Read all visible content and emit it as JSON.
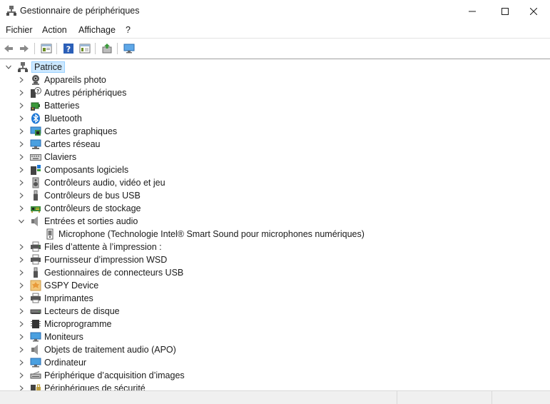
{
  "window": {
    "title": "Gestionnaire de périphériques"
  },
  "menu": {
    "items": [
      "Fichier",
      "Action",
      "Affichage",
      "?"
    ]
  },
  "toolbar": {
    "buttons": [
      "back-icon",
      "forward-icon",
      "properties-icon",
      "help-icon",
      "view-icon",
      "update-driver-icon",
      "monitor-scan-icon"
    ]
  },
  "tree": {
    "root": "Patrice",
    "categories": [
      {
        "label": "Appareils photo",
        "icon": "camera-icon",
        "expanded": false
      },
      {
        "label": "Autres périphériques",
        "icon": "unknown-device-icon",
        "expanded": false
      },
      {
        "label": "Batteries",
        "icon": "battery-icon",
        "expanded": false
      },
      {
        "label": "Bluetooth",
        "icon": "bluetooth-icon",
        "expanded": false
      },
      {
        "label": "Cartes graphiques",
        "icon": "display-adapter-icon",
        "expanded": false
      },
      {
        "label": "Cartes réseau",
        "icon": "network-adapter-icon",
        "expanded": false
      },
      {
        "label": "Claviers",
        "icon": "keyboard-icon",
        "expanded": false
      },
      {
        "label": "Composants logiciels",
        "icon": "software-component-icon",
        "expanded": false
      },
      {
        "label": "Contrôleurs audio, vidéo et jeu",
        "icon": "audio-controller-icon",
        "expanded": false
      },
      {
        "label": "Contrôleurs de bus USB",
        "icon": "usb-icon",
        "expanded": false
      },
      {
        "label": "Contrôleurs de stockage",
        "icon": "storage-controller-icon",
        "expanded": false
      },
      {
        "label": "Entrées et sorties audio",
        "icon": "speaker-icon",
        "expanded": true,
        "children": [
          {
            "label": "Microphone (Technologie Intel® Smart Sound pour microphones numériques)",
            "icon": "microphone-icon"
          }
        ]
      },
      {
        "label": "Files d’attente à l’impression :",
        "icon": "print-queue-icon",
        "expanded": false
      },
      {
        "label": "Fournisseur d’impression WSD",
        "icon": "printer-icon",
        "expanded": false
      },
      {
        "label": "Gestionnaires de connecteurs USB",
        "icon": "usb-connector-icon",
        "expanded": false
      },
      {
        "label": "GSPY Device",
        "icon": "gspy-device-icon",
        "expanded": false
      },
      {
        "label": "Imprimantes",
        "icon": "printer-icon",
        "expanded": false
      },
      {
        "label": "Lecteurs de disque",
        "icon": "disk-drive-icon",
        "expanded": false
      },
      {
        "label": "Microprogramme",
        "icon": "firmware-icon",
        "expanded": false
      },
      {
        "label": "Moniteurs",
        "icon": "monitor-icon",
        "expanded": false
      },
      {
        "label": "Objets de traitement audio (APO)",
        "icon": "speaker-icon",
        "expanded": false
      },
      {
        "label": "Ordinateur",
        "icon": "computer-icon",
        "expanded": false
      },
      {
        "label": "Périphérique d’acquisition d’images",
        "icon": "scanner-icon",
        "expanded": false
      },
      {
        "label": "Périphériques de sécurité",
        "icon": "security-device-icon",
        "expanded": false
      }
    ]
  },
  "colors": {
    "selection_bg": "#cce8ff",
    "selection_border": "#99d1ff",
    "accent_blue": "#1e78d7"
  }
}
